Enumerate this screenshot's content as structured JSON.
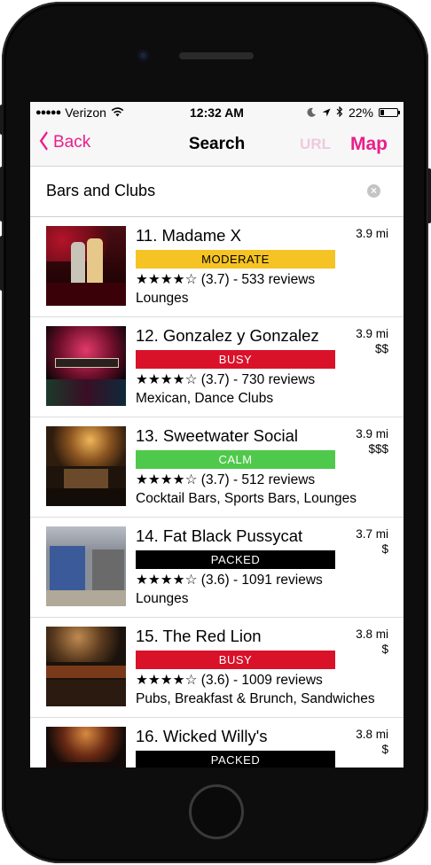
{
  "status_bar": {
    "carrier": "Verizon",
    "signal": "●●●●●",
    "time": "12:32 AM",
    "battery": "22%",
    "battery_level": 0.22
  },
  "nav": {
    "back_label": "Back",
    "title": "Search",
    "url_label": "URL",
    "map_label": "Map"
  },
  "search": {
    "value": "Bars and Clubs"
  },
  "colors": {
    "accent": "#ea1e8b",
    "moderate": "#f5c324",
    "busy": "#d9122a",
    "calm": "#4fc94b",
    "packed": "#000000"
  },
  "results": [
    {
      "name": "11. Madame X",
      "status": "MODERATE",
      "status_color": "#f5c324",
      "status_text_color": "#000000",
      "rating": "★★★★☆ (3.7) - 533 reviews",
      "categories": "Lounges",
      "distance": "3.9 mi",
      "price": ""
    },
    {
      "name": "12. Gonzalez y Gonzalez",
      "status": "BUSY",
      "status_color": "#d9122a",
      "status_text_color": "#ffffff",
      "rating": "★★★★☆ (3.7) - 730 reviews",
      "categories": "Mexican, Dance Clubs",
      "distance": "3.9 mi",
      "price": "$$"
    },
    {
      "name": "13. Sweetwater Social",
      "status": "CALM",
      "status_color": "#4fc94b",
      "status_text_color": "#ffffff",
      "rating": "★★★★☆ (3.7) - 512 reviews",
      "categories": "Cocktail Bars, Sports Bars, Lounges",
      "distance": "3.9 mi",
      "price": "$$$"
    },
    {
      "name": "14. Fat Black Pussycat",
      "status": "PACKED",
      "status_color": "#000000",
      "status_text_color": "#ffffff",
      "rating": "★★★★☆ (3.6) - 1091 reviews",
      "categories": "Lounges",
      "distance": "3.7 mi",
      "price": "$"
    },
    {
      "name": "15. The Red Lion",
      "status": "BUSY",
      "status_color": "#d9122a",
      "status_text_color": "#ffffff",
      "rating": "★★★★☆ (3.6) - 1009 reviews",
      "categories": "Pubs, Breakfast & Brunch, Sandwiches",
      "distance": "3.8 mi",
      "price": "$"
    },
    {
      "name": "16. Wicked Willy's",
      "status": "PACKED",
      "status_color": "#000000",
      "status_text_color": "#ffffff",
      "rating": "",
      "categories": "",
      "distance": "3.8 mi",
      "price": "$"
    }
  ]
}
